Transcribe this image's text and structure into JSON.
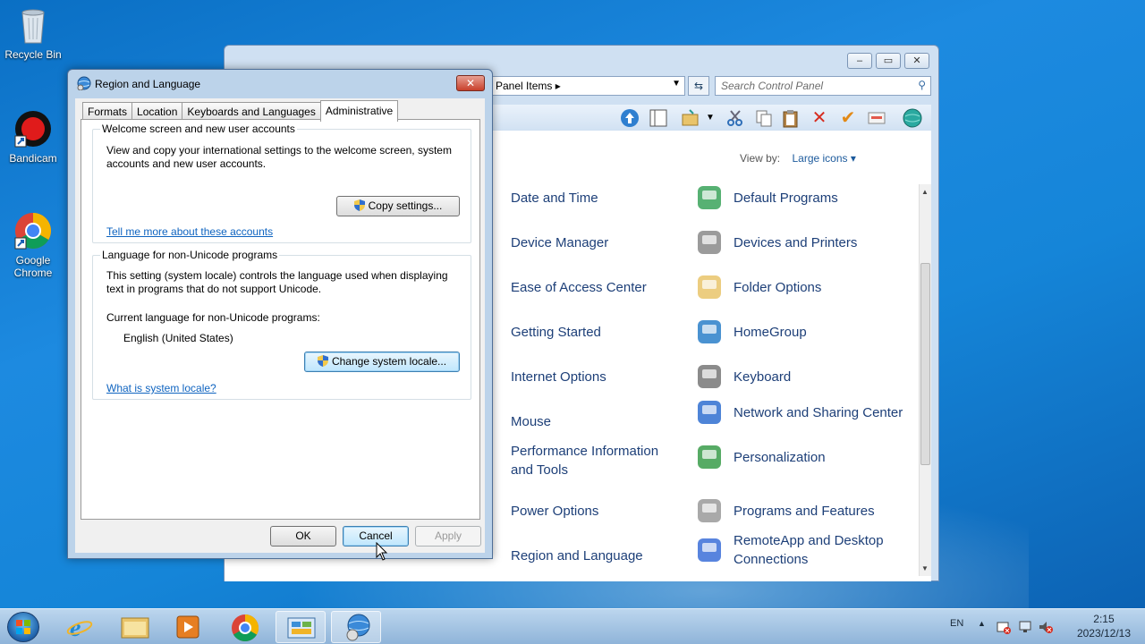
{
  "desktop": {
    "icons": [
      {
        "label": "Recycle Bin"
      },
      {
        "label": "Bandicam"
      },
      {
        "label": "Google Chrome"
      }
    ]
  },
  "control_panel": {
    "window_controls": [
      "–",
      "▭",
      "✕"
    ],
    "address": "Panel Items",
    "search_placeholder": "Search Control Panel",
    "view_by_label": "View by:",
    "view_by_value": "Large icons",
    "items_left": [
      {
        "label": "Date and Time",
        "icon": "clock-icon"
      },
      {
        "label": "Device Manager",
        "icon": "device-manager-icon"
      },
      {
        "label": "Ease of Access Center",
        "icon": "ease-of-access-icon"
      },
      {
        "label": "Getting Started",
        "icon": "getting-started-icon"
      },
      {
        "label": "Internet Options",
        "icon": "internet-options-icon"
      },
      {
        "label": "Mouse",
        "icon": "mouse-icon"
      },
      {
        "label": "Performance Information and Tools",
        "icon": "performance-icon"
      },
      {
        "label": "Power Options",
        "icon": "power-icon"
      },
      {
        "label": "Region and Language",
        "icon": "region-icon"
      }
    ],
    "items_right": [
      {
        "label": "Default Programs",
        "icon": "default-programs-icon"
      },
      {
        "label": "Devices and Printers",
        "icon": "printer-icon"
      },
      {
        "label": "Folder Options",
        "icon": "folder-icon"
      },
      {
        "label": "HomeGroup",
        "icon": "homegroup-icon"
      },
      {
        "label": "Keyboard",
        "icon": "keyboard-icon"
      },
      {
        "label": "Network and Sharing Center",
        "icon": "network-icon"
      },
      {
        "label": "Personalization",
        "icon": "personalization-icon"
      },
      {
        "label": "Programs and Features",
        "icon": "programs-icon"
      },
      {
        "label": "RemoteApp and Desktop Connections",
        "icon": "remoteapp-icon"
      }
    ]
  },
  "dialog": {
    "title": "Region and Language",
    "close": "✕",
    "tabs": [
      "Formats",
      "Location",
      "Keyboards and Languages",
      "Administrative"
    ],
    "active_tab": "Administrative",
    "welcome_group": {
      "legend": "Welcome screen and new user accounts",
      "description": "View and copy your international settings to the welcome screen, system accounts and new user accounts.",
      "button": "Copy settings...",
      "link": "Tell me more about these accounts"
    },
    "unicode_group": {
      "legend": "Language for non-Unicode programs",
      "description": "This setting (system locale) controls the language used when displaying text in programs that do not support Unicode.",
      "current_label": "Current language for non-Unicode programs:",
      "current_value": "English (United States)",
      "button": "Change system locale...",
      "link": "What is system locale?"
    },
    "buttons": {
      "ok": "OK",
      "cancel": "Cancel",
      "apply": "Apply"
    }
  },
  "taskbar": {
    "language": "EN",
    "time": "2:15",
    "date": "2023/12/13"
  }
}
